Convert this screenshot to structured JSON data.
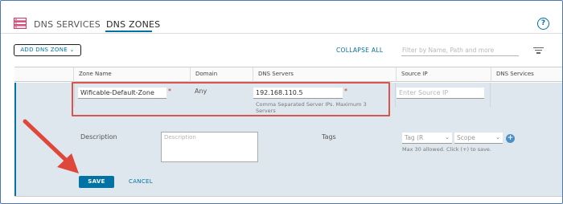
{
  "header": {
    "tabs": [
      {
        "label": "DNS SERVICES"
      },
      {
        "label": "DNS ZONES",
        "active": true
      }
    ],
    "help_label": "?"
  },
  "toolbar": {
    "add_label": "ADD DNS ZONE",
    "add_chevron": "⌄",
    "collapse_label": "COLLAPSE ALL",
    "filter_placeholder": "Filter by Name, Path and more"
  },
  "table": {
    "columns": [
      "Zone Name",
      "Domain",
      "DNS Servers",
      "Source IP",
      "DNS Services"
    ]
  },
  "form": {
    "zone_name_value": "Wificable-Default-Zone",
    "required_mark": "*",
    "domain_value": "Any",
    "dns_servers_value": "192.168.110.5",
    "dns_servers_hint": "Comma Separated Server IPs. Maximum 3 Servers",
    "source_ip_placeholder": "Enter Source IP",
    "description_label": "Description",
    "description_placeholder": "Description",
    "tags_label": "Tags",
    "tag_placeholder": "Tag (R",
    "scope_placeholder": "Scope",
    "tags_hint": "Max 30 allowed. Click (+) to save.",
    "add_tag_label": "+",
    "save_label": "SAVE",
    "cancel_label": "CANCEL"
  },
  "colors": {
    "accent": "#0072a3",
    "highlight": "#d9534f",
    "annotation_arrow": "#e0473b",
    "row_expanded_bg": "#dfe7ee",
    "icon_pink": "#d23b6e"
  },
  "icons": [
    "dns-services-icon",
    "help-icon",
    "filter-icon",
    "chevron-down-icon",
    "add-tag-icon",
    "annotation-arrow"
  ]
}
